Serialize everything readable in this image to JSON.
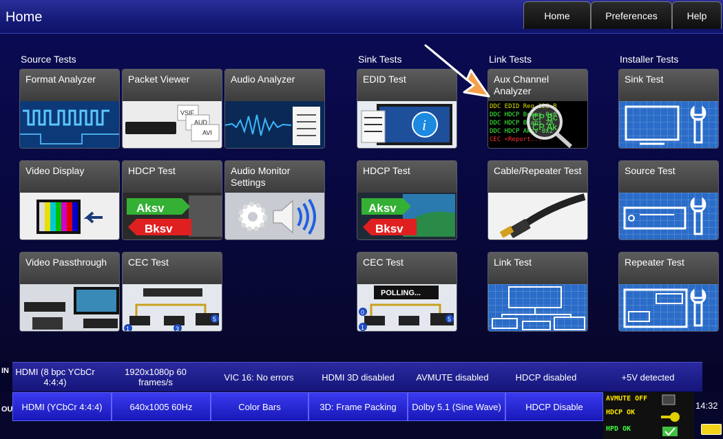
{
  "header": {
    "title": "Home",
    "tabs": [
      "Home",
      "Preferences",
      "Help"
    ]
  },
  "sections": {
    "source": "Source Tests",
    "sink": "Sink Tests",
    "link": "Link Tests",
    "installer": "Installer Tests"
  },
  "tiles": {
    "format_analyzer": "Format Analyzer",
    "packet_viewer": "Packet Viewer",
    "audio_analyzer": "Audio Analyzer",
    "edid_test": "EDID Test",
    "aux_channel": "Aux Channel Analyzer",
    "sink_test": "Sink Test",
    "video_display": "Video Display",
    "hdcp_test_source": "HDCP Test",
    "audio_monitor": "Audio Monitor Settings",
    "hdcp_test_sink": "HDCP Test",
    "cable_repeater": "Cable/Repeater Test",
    "source_test": "Source Test",
    "video_passthrough": "Video Passthrough",
    "cec_test_source": "CEC Test",
    "cec_test_sink": "CEC Test",
    "link_test": "Link Test",
    "repeater_test": "Repeater Test"
  },
  "tile_graphics": {
    "packet_viewer": [
      "VSIF",
      "AUD",
      "AVI"
    ],
    "hdcp": [
      "Aksv",
      "Bksv"
    ],
    "cec_polling": "POLLING...",
    "aux_text": [
      "DDC EDID Req 128 B",
      "DDC HDCP Bcaps 0x0",
      "DDC HDCP Bcaps 28",
      "DDC HDCP Aksv 0x2",
      "CEC <Report..."
    ],
    "aux_magnify": [
      "CP Bc",
      "CP Ak"
    ],
    "cec_badges": [
      "1",
      "3",
      "5"
    ],
    "cec_sink_badges": [
      "0",
      "1",
      "5"
    ]
  },
  "status": {
    "in_label": "IN",
    "out_label": "OUT",
    "in_cells": [
      "HDMI (8 bpc YCbCr 4:4:4)",
      "1920x1080p 60 frames/s",
      "VIC 16: No errors",
      "HDMI 3D disabled",
      "AVMUTE disabled",
      "HDCP disabled",
      "+5V detected"
    ],
    "out_buttons": [
      "HDMI (YCbCr 4:4:4)",
      "640x1005 60Hz",
      "Color Bars",
      "3D: Frame Packing",
      "Dolby 5.1 (Sine Wave)",
      "HDCP Disable"
    ],
    "indicators": [
      "AVMUTE OFF",
      "HDCP OK",
      "HPD OK"
    ],
    "time": "14:32"
  }
}
